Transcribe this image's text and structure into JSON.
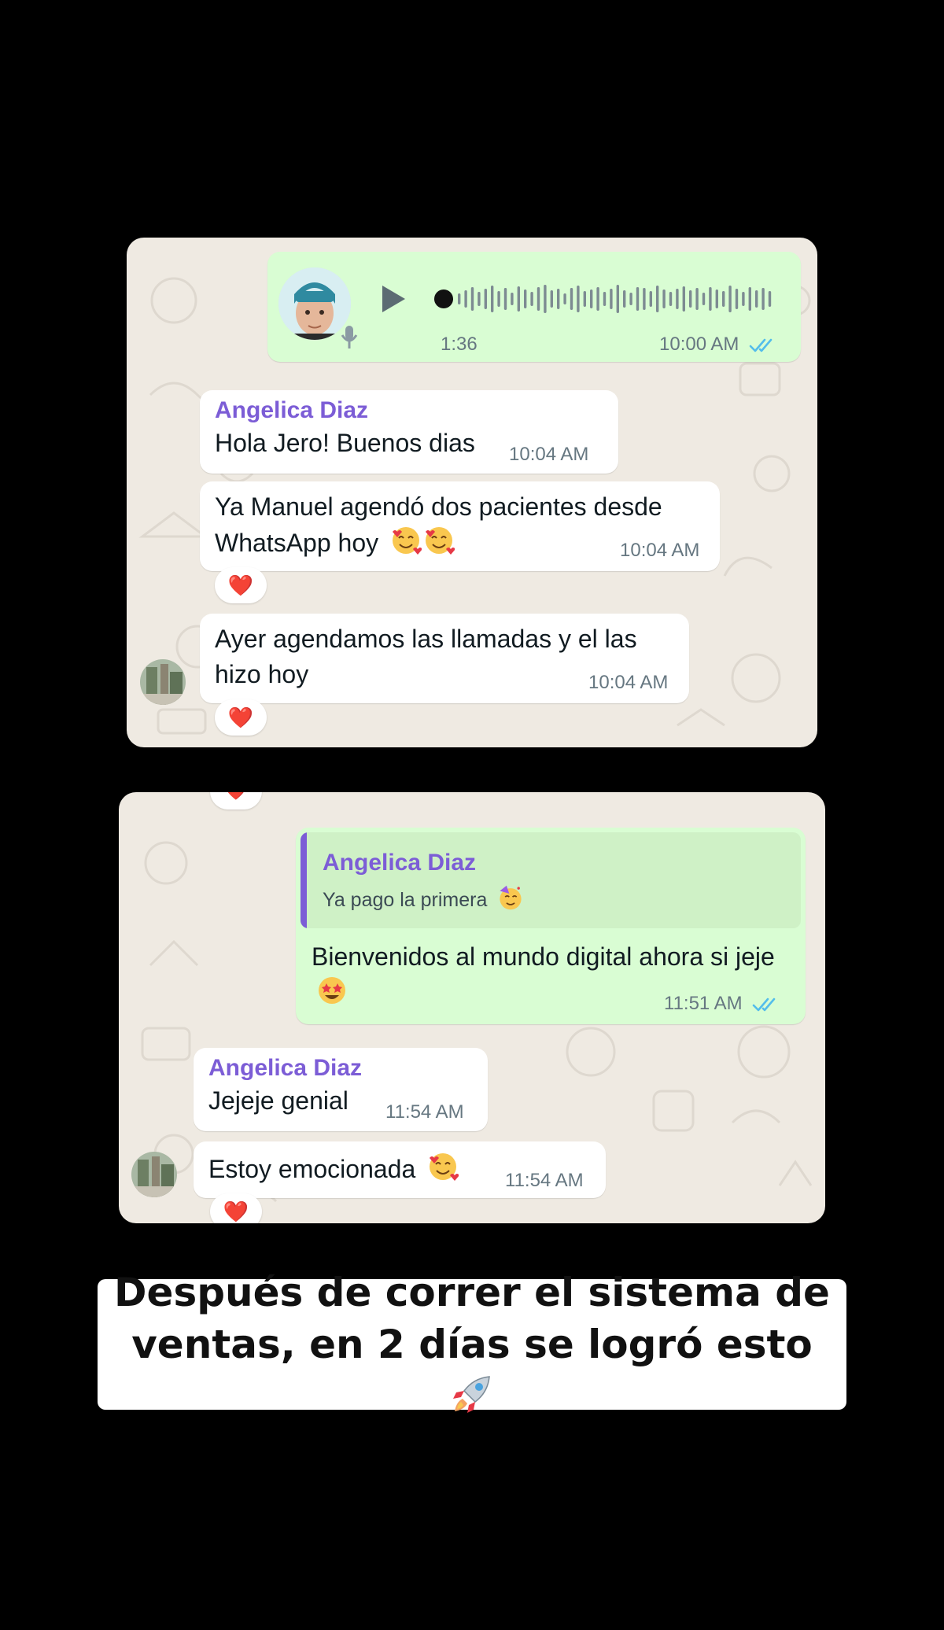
{
  "panel1": {
    "voice_note": {
      "duration": "1:36",
      "time": "10:00 AM",
      "status": "read"
    },
    "messages": [
      {
        "sender": "Angelica Diaz",
        "text": "Hola Jero! Buenos dias",
        "time": "10:04 AM"
      },
      {
        "text": "Ya Manuel agendó dos pacientes desde WhatsApp hoy",
        "emojis": [
          "smiling-face-with-hearts",
          "smiling-face-with-hearts"
        ],
        "time": "10:04 AM",
        "reaction": "❤️"
      },
      {
        "text": "Ayer agendamos las llamadas y el las hizo hoy",
        "time": "10:04 AM",
        "reaction": "❤️"
      }
    ]
  },
  "panel2": {
    "reply_message": {
      "quoted_sender": "Angelica Diaz",
      "quoted_text": "Ya pago la primera",
      "quoted_emoji": "partying-face",
      "text": "Bienvenidos al mundo digital ahora si jeje",
      "emoji": "star-struck",
      "time": "11:51 AM",
      "status": "read"
    },
    "messages": [
      {
        "sender": "Angelica Diaz",
        "text": "Jejeje genial",
        "time": "11:54 AM"
      },
      {
        "text": "Estoy emocionada",
        "emoji": "smiling-face-with-hearts",
        "time": "11:54 AM",
        "reaction": "❤️"
      }
    ]
  },
  "caption": {
    "text": "Después de correr el sistema de ventas, en 2 días se logró esto",
    "emoji": "rocket"
  },
  "colors": {
    "background": "#000000",
    "chat_wallpaper": "#efeae2",
    "outgoing_bubble": "#d9fdd3",
    "incoming_bubble": "#ffffff",
    "sender_name": "#7c5dd6",
    "read_ticks": "#53bdeb"
  }
}
